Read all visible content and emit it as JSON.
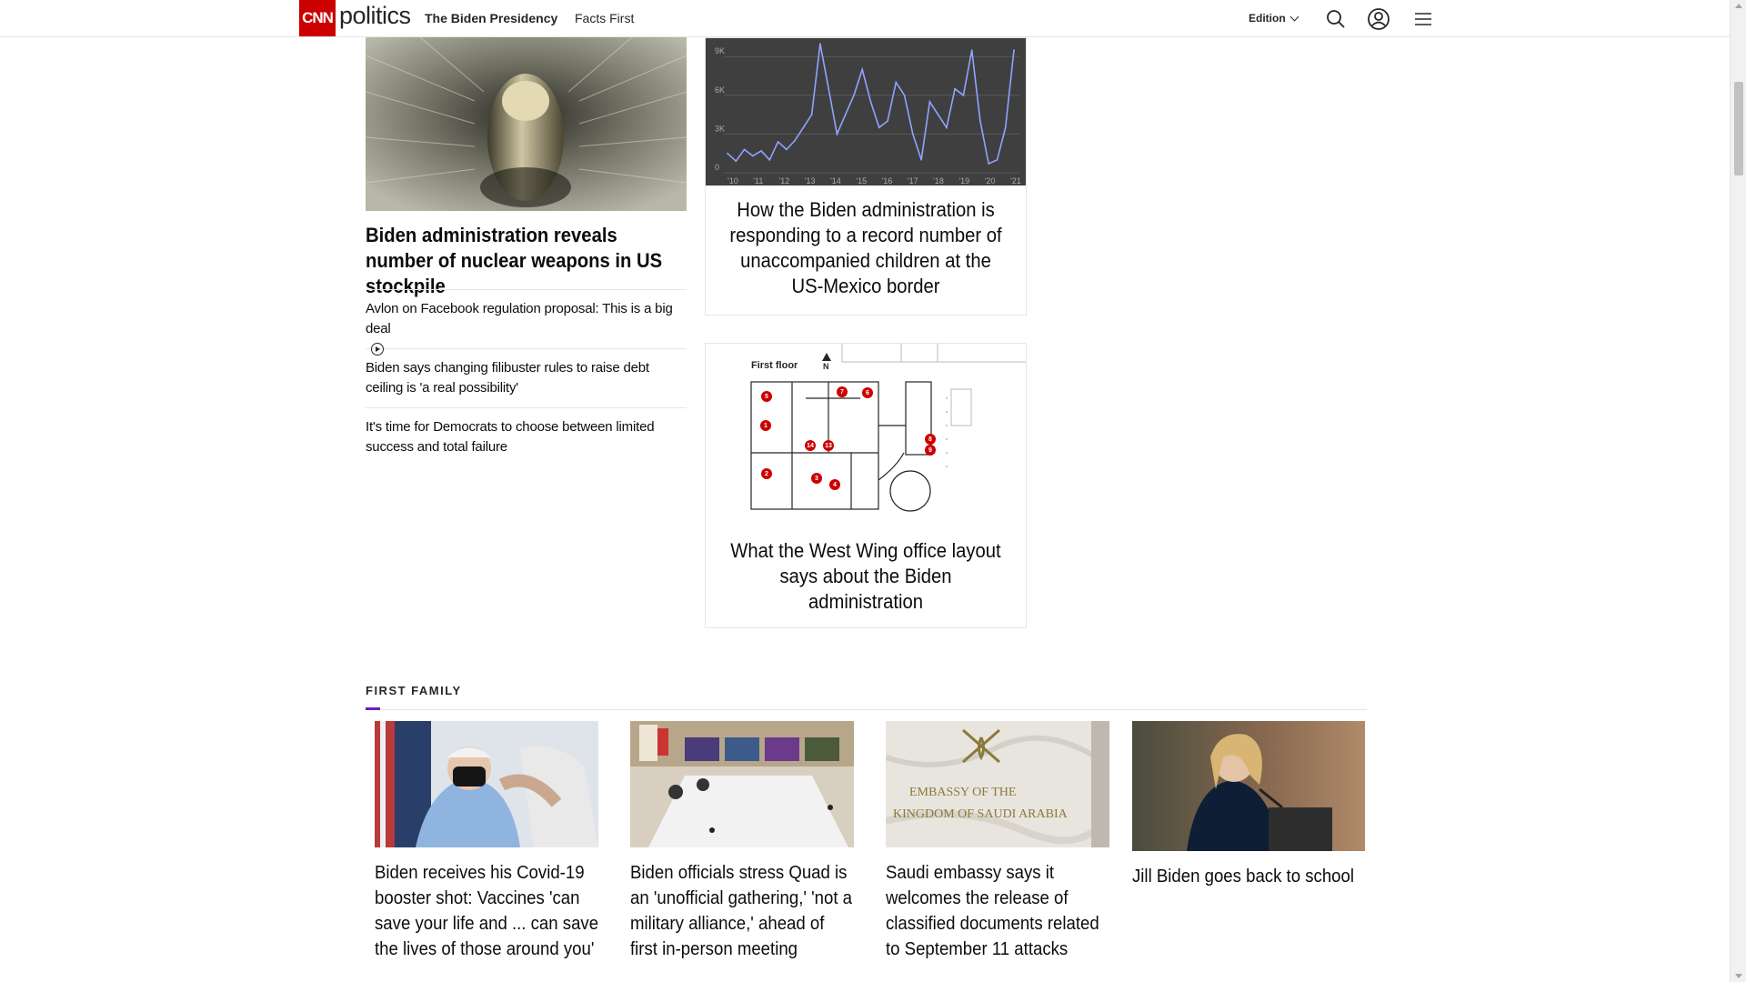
{
  "header": {
    "logo": "CNN",
    "section": "politics",
    "nav": [
      "The Biden Presidency",
      "Facts First"
    ],
    "edition_label": "Edition"
  },
  "lead": {
    "title": "Biden administration reveals number of nuclear weapons in US stockpile",
    "related": [
      "Avlon on Facebook regulation proposal: This is a big deal",
      "Biden says changing filibuster rules to raise debt ceiling is 'a real possibility'",
      "It's time for Democrats to choose between limited success and total failure"
    ]
  },
  "cards": {
    "chart_title": "How the Biden administration is responding to a record number of unaccompanied children at the US-Mexico border",
    "plan_title": "What the West Wing office layout says about the Biden administration"
  },
  "chart_data": {
    "type": "line",
    "x": [
      "'10",
      "'11",
      "'12",
      "'13",
      "'14",
      "'15",
      "'16",
      "'17",
      "'18",
      "'19",
      "'20",
      "'21"
    ],
    "yticks": [
      "0",
      "3K",
      "6K",
      "9K"
    ],
    "ylim": [
      0,
      10000
    ],
    "values": [
      1500,
      900,
      1800,
      1300,
      1700,
      1000,
      2400,
      1800,
      2500,
      3500,
      4500,
      10000,
      6500,
      3000,
      4500,
      6000,
      8000,
      5500,
      3500,
      4000,
      7000,
      6000,
      3000,
      1000,
      5500,
      4500,
      3500,
      6500,
      6000,
      9500,
      4000,
      700,
      1000,
      3500,
      9500
    ],
    "title": "",
    "xlabel": "",
    "ylabel": ""
  },
  "floor_plan": {
    "title": "First floor",
    "north": "N",
    "markers": [
      "5",
      "7",
      "6",
      "1",
      "14",
      "13",
      "8",
      "9",
      "2",
      "3",
      "4"
    ]
  },
  "first_family": {
    "label": "FIRST FAMILY",
    "items": [
      {
        "title": "Biden receives his Covid-19 booster shot: Vaccines 'can save your life and ... can save the lives of those around you'"
      },
      {
        "title": "Biden officials stress Quad is an 'unofficial gathering,' 'not a military alliance,' ahead of first in-person meeting"
      },
      {
        "title": "Saudi embassy says it welcomes the release of classified documents related to September 11 attacks"
      },
      {
        "title": "Jill Biden goes back to school"
      }
    ],
    "embassy_sign": [
      "EMBASSY OF THE",
      "KINGDOM OF SAUDI ARABIA"
    ]
  }
}
